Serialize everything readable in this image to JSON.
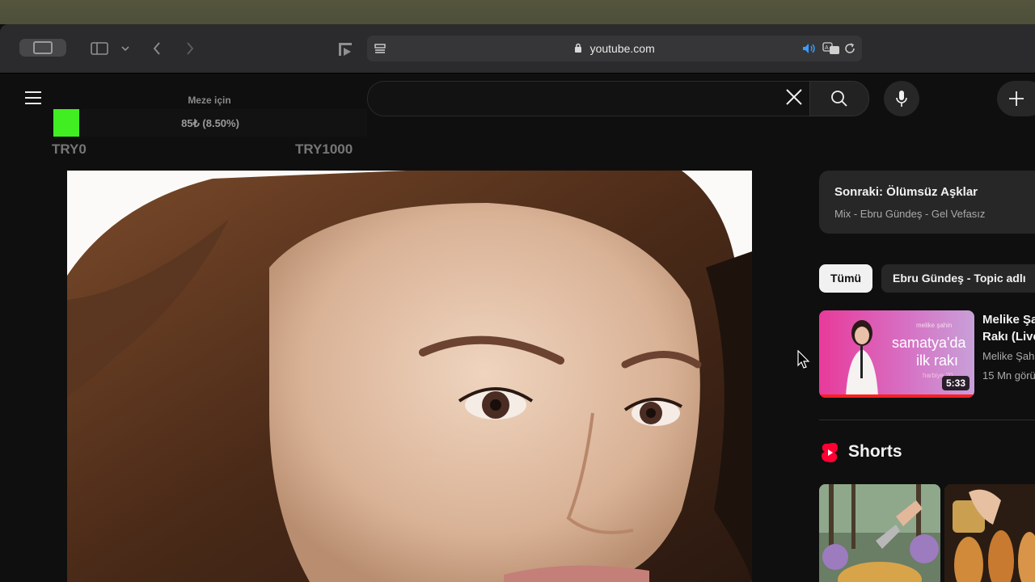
{
  "browser": {
    "url": "youtube.com"
  },
  "overlay": {
    "title": "Meze için",
    "value_text": "85₺ (8.50%)",
    "progress_percent": 8.5,
    "min_label": "TRY0",
    "max_label": "TRY1000",
    "fill_color": "#40ee22"
  },
  "up_next": {
    "title": "Sonraki: Ölümsüz Aşklar",
    "subtitle": "Mix - Ebru Gündeş - Gel Vefasız"
  },
  "chips": [
    "Tümü",
    "Ebru Gündeş - Topic adlı"
  ],
  "recommendation": {
    "title_line1": "Melike Şa",
    "title_line2": "Rakı (Live",
    "channel": "Melike Şah",
    "views": "15 Mn görü",
    "duration": "5:33",
    "thumb_text": {
      "small_top": "melike şahin",
      "big_line1": "samatya'da",
      "big_line2": "ilk rakı",
      "small_bottom": "harbiye 20"
    }
  },
  "shorts": {
    "heading": "Shorts"
  },
  "colors": {
    "accent_red": "#ff0000",
    "youtube_bg": "#0f0f0f"
  }
}
